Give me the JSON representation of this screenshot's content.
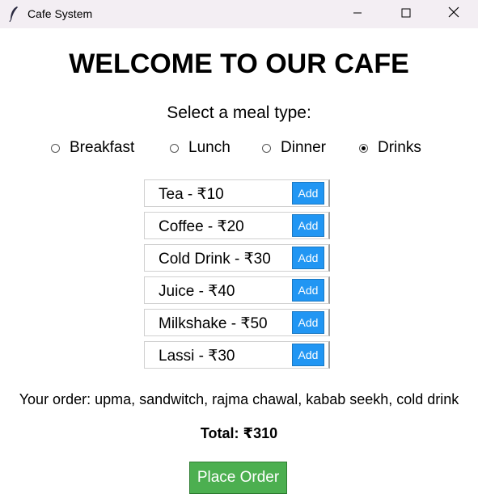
{
  "window": {
    "title": "Cafe System"
  },
  "main": {
    "heading": "WELCOME TO OUR CAFE",
    "subheading": "Select a meal type:",
    "meal_types": [
      {
        "label": "Breakfast",
        "selected": false
      },
      {
        "label": "Lunch",
        "selected": false
      },
      {
        "label": "Dinner",
        "selected": false
      },
      {
        "label": "Drinks",
        "selected": true
      }
    ],
    "items": [
      {
        "label": "Tea - ₹10",
        "button": "Add"
      },
      {
        "label": "Coffee - ₹20",
        "button": "Add"
      },
      {
        "label": "Cold Drink - ₹30",
        "button": "Add"
      },
      {
        "label": "Juice - ₹40",
        "button": "Add"
      },
      {
        "label": "Milkshake - ₹50",
        "button": "Add"
      },
      {
        "label": "Lassi - ₹30",
        "button": "Add"
      }
    ],
    "order_text": "Your order: upma, sandwitch, rajma chawal, kabab seekh, cold drink",
    "total_text": "Total: ₹310",
    "place_order_label": "Place Order"
  },
  "colors": {
    "titlebar": "#f3eef3",
    "add_button": "#2196f3",
    "place_order_button": "#4caf50"
  },
  "icons": [
    "feather-app-icon",
    "minimize-icon",
    "maximize-icon",
    "close-icon"
  ]
}
